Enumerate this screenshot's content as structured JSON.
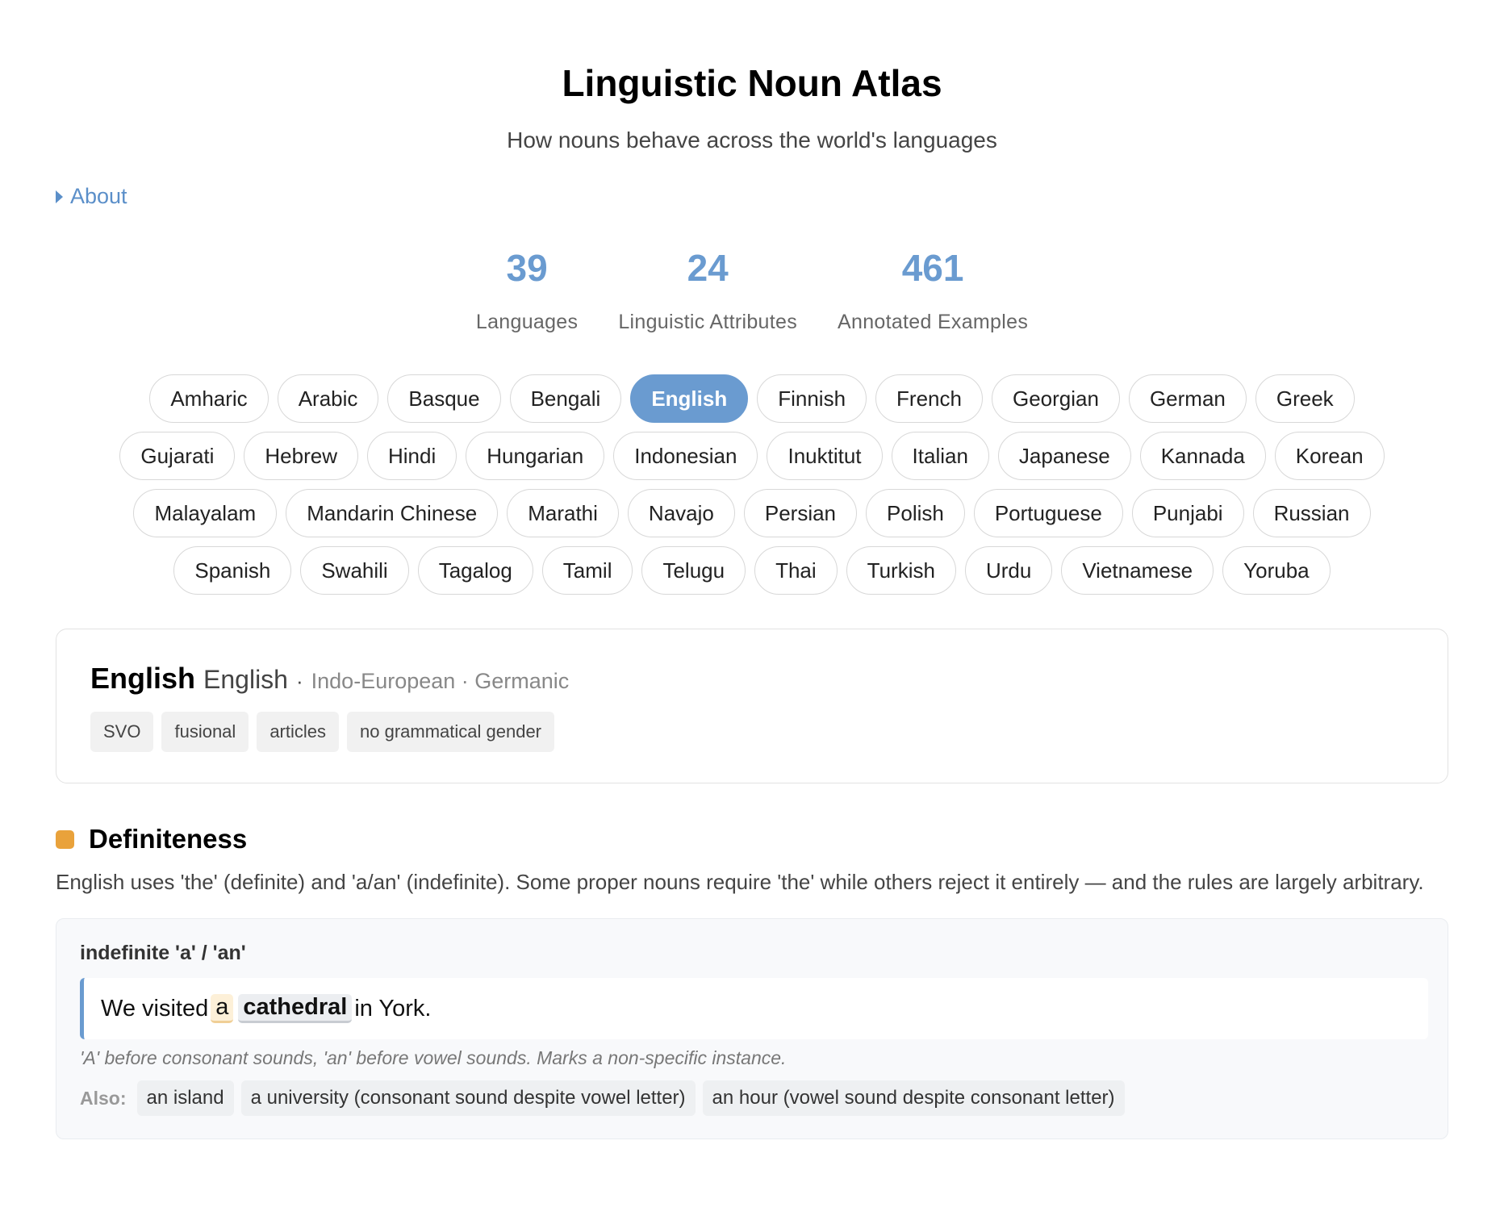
{
  "header": {
    "title": "Linguistic Noun Atlas",
    "subtitle": "How nouns behave across the world's languages"
  },
  "about": {
    "label": "About"
  },
  "stats": [
    {
      "value": "39",
      "label": "Languages"
    },
    {
      "value": "24",
      "label": "Linguistic Attributes"
    },
    {
      "value": "461",
      "label": "Annotated Examples"
    }
  ],
  "languages": {
    "selected": "English",
    "items": [
      "Amharic",
      "Arabic",
      "Basque",
      "Bengali",
      "English",
      "Finnish",
      "French",
      "Georgian",
      "German",
      "Greek",
      "Gujarati",
      "Hebrew",
      "Hindi",
      "Hungarian",
      "Indonesian",
      "Inuktitut",
      "Italian",
      "Japanese",
      "Kannada",
      "Korean",
      "Malayalam",
      "Mandarin Chinese",
      "Marathi",
      "Navajo",
      "Persian",
      "Polish",
      "Portuguese",
      "Punjabi",
      "Russian",
      "Spanish",
      "Swahili",
      "Tagalog",
      "Tamil",
      "Telugu",
      "Thai",
      "Turkish",
      "Urdu",
      "Vietnamese",
      "Yoruba"
    ]
  },
  "language_card": {
    "name": "English",
    "native": "English",
    "separator": "·",
    "family": "Indo-European · Germanic",
    "tags": [
      "SVO",
      "fusional",
      "articles",
      "no grammatical gender"
    ]
  },
  "section": {
    "title": "Definiteness",
    "color": "#e9a23b",
    "description": "English uses 'the' (definite) and 'a/an' (indefinite). Some proper nouns require 'the' while others reject it entirely — and the rules are largely arbitrary.",
    "example": {
      "title": "indefinite 'a' / 'an'",
      "sentence": {
        "before": "We visited",
        "article": "a",
        "noun": "cathedral",
        "after": "in York."
      },
      "note": "'A' before consonant sounds, 'an' before vowel sounds. Marks a non-specific instance.",
      "also_label": "Also:",
      "also": [
        "an island",
        "a university (consonant sound despite vowel letter)",
        "an hour (vowel sound despite consonant letter)"
      ]
    }
  },
  "colors": {
    "accent": "#6a9bd0",
    "article_highlight": "#fdf0d8",
    "noun_highlight": "#eceef1"
  }
}
